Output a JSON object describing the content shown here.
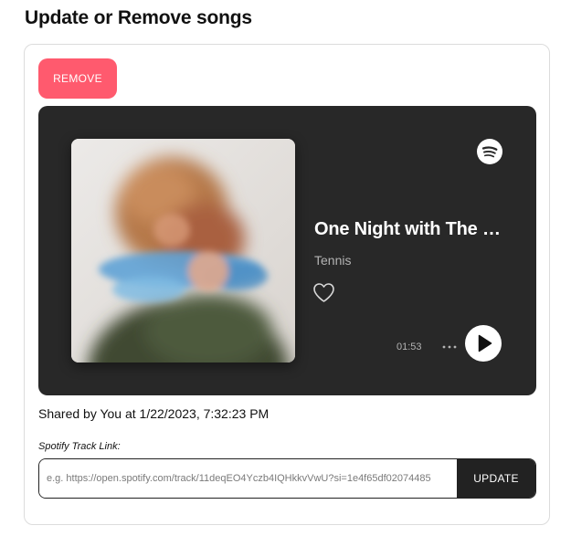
{
  "page": {
    "title": "Update or Remove songs"
  },
  "card": {
    "remove_label": "REMOVE",
    "player": {
      "track_title": "One Night with The …",
      "artist": "Tennis",
      "duration": "01:53",
      "icons": {
        "brand": "spotify-icon",
        "like": "heart-icon",
        "more": "more-horizontal-icon",
        "play": "play-icon"
      },
      "colors": {
        "background": "#282828",
        "title": "#ffffff",
        "secondary": "#b3b3b3"
      }
    },
    "shared_text": "Shared by You at 1/22/2023, 7:32:23 PM",
    "link_label": "Spotify Track Link:",
    "link_input": {
      "value": "",
      "placeholder": "e.g. https://open.spotify.com/track/11deqEO4Yczb4IQHkkvVwU?si=1e4f65df02074485"
    },
    "update_label": "UPDATE",
    "colors": {
      "remove_button": "#ff5a6e",
      "update_button": "#222222"
    }
  }
}
